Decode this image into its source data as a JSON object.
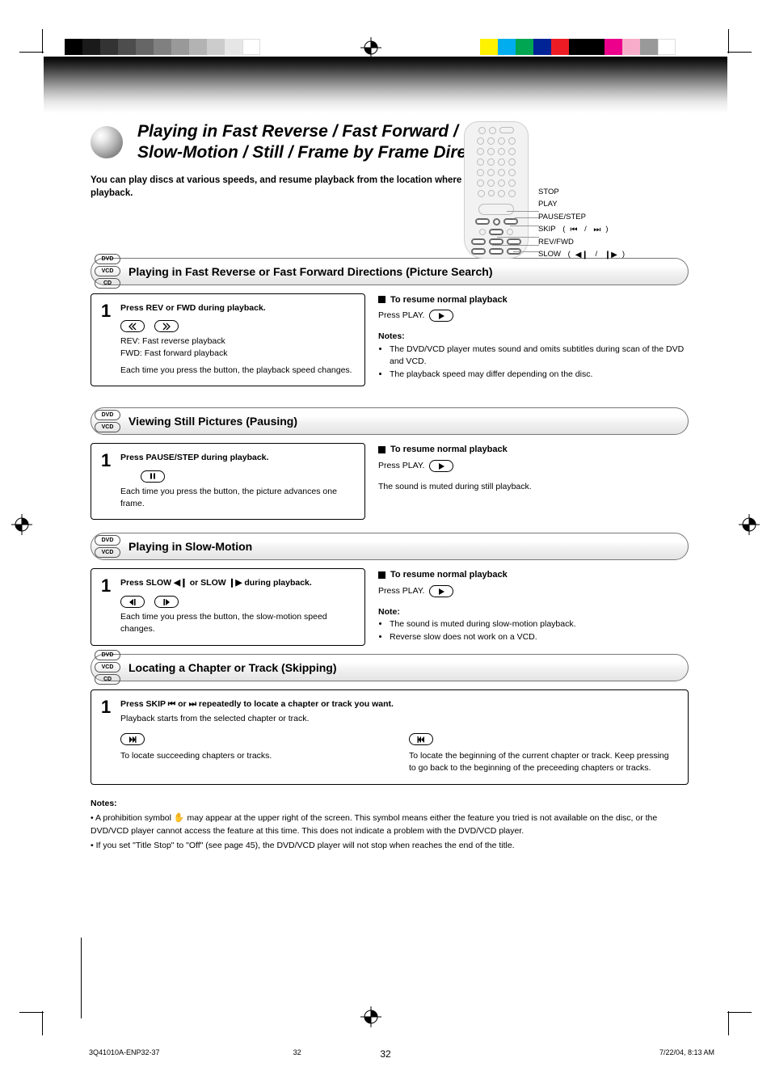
{
  "page": {
    "number": "32",
    "footer_path": "3Q41010A-ENP32-37",
    "footer_pagenum": "32",
    "footer_date": "7/22/04, 8:13 AM"
  },
  "header": {
    "title_line1": "Playing in Fast Reverse / Fast Forward /",
    "title_line2": "Slow-Motion / Still / Frame by Frame Directions",
    "intro1": "You can play discs at various speeds, and resume playback from the location where you stopped",
    "intro2": "playback."
  },
  "remote_legend": {
    "stop": "STOP",
    "play": "PLAY",
    "pause": "PAUSE/STEP",
    "skip": "SKIP",
    "rev_fwd": "REV/FWD",
    "slow": "SLOW"
  },
  "disc_badges": {
    "dvd": "DVD",
    "vcd": "VCD",
    "cd": "CD"
  },
  "sections": {
    "fast": {
      "title": "Playing in Fast Reverse or Fast Forward Directions (Picture Search)",
      "step_text1": "Press REV or FWD during playback.",
      "step_icons_caption": "REV: Fast reverse playback\nFWD: Fast forward playback",
      "step_text2": "Each time you press the button, the playback speed changes.",
      "resume_head": "To resume normal playback",
      "resume_text": "Press PLAY.",
      "notes_head": "Notes:",
      "notes": [
        "The DVD/VCD player mutes sound and omits subtitles during scan of the DVD and VCD.",
        "The playback speed may differ depending on the disc."
      ]
    },
    "still": {
      "title": "Viewing Still Pictures (Pausing)",
      "step_text1": "Press PAUSE/STEP during playback.",
      "step_text2": "Each time you press the button, the picture advances one frame.",
      "resume_head": "To resume normal playback",
      "resume_text": "Press PLAY.",
      "note": "The sound is muted during still playback."
    },
    "slow": {
      "title": "Playing in Slow-Motion",
      "step_text1": "Press SLOW       or SLOW       during playback.",
      "step_text2": "Each time you press the button, the slow-motion speed changes.",
      "resume_head": "To resume normal playback",
      "resume_text": "Press PLAY.",
      "notes_head": "Note:",
      "notes": [
        "The sound is muted during slow-motion playback.",
        "Reverse slow does not work on a VCD."
      ]
    },
    "chapter": {
      "title": "Locating a Chapter or Track (Skipping)",
      "step_text1": "Press SKIP       or       repeatedly to locate a chapter or track you want.",
      "step_text2": "Playback starts from the selected chapter or track.",
      "to_locate_fwd": "To locate succeeding chapters or tracks.",
      "to_locate_back": "To locate the beginning of the current chapter or track. Keep pressing to go back to the beginning of the preceeding chapters or tracks.",
      "notes_head": "Notes:",
      "notes_line1": "• A prohibition symbol       may appear at the upper right of the screen. This symbol means either the feature you tried is not available on the disc, or the DVD/VCD player cannot access the feature at this time. This does not indicate a problem with the DVD/VCD player.",
      "notes_line2": "• If you set \"Title Stop\" to \"Off\" (see page 45), the DVD/VCD player will not stop when reaches the end of the title."
    }
  }
}
